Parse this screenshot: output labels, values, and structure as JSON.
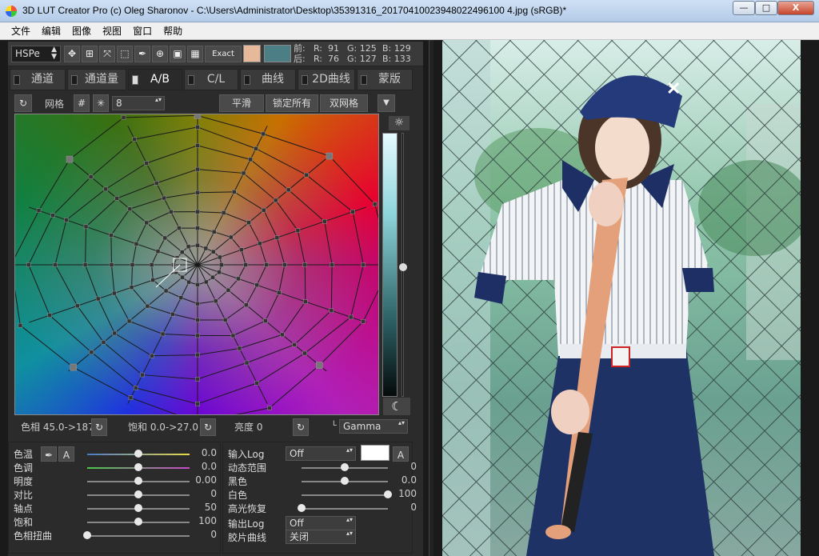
{
  "window": {
    "title": "3D LUT Creator Pro (c) Oleg Sharonov - C:\\Users\\Administrator\\Desktop\\35391316_20170410023948022496100 4.jpg (sRGB)*",
    "min": "—",
    "max": "□",
    "close": "X"
  },
  "menu": [
    "文件",
    "编辑",
    "图像",
    "视图",
    "窗口",
    "帮助"
  ],
  "toolbar": {
    "mode": "HSPe",
    "exact": "Exact",
    "before_label": "前:",
    "after_label": "后:",
    "before_r": "R:  91",
    "before_g": "G: 125",
    "before_b": "B: 129",
    "after_r": "R:  76",
    "after_g": "G: 127",
    "after_b": "B: 133",
    "before_color": "#e8b89a",
    "after_color": "#4c7f85"
  },
  "tabs": [
    "通道",
    "通道量",
    "A/B",
    "C/L",
    "曲线",
    "2D曲线",
    "蒙版"
  ],
  "grid_row": {
    "label": "网格",
    "value": "8",
    "smooth": "平滑",
    "lock_all": "锁定所有",
    "dual_grid": "双网格"
  },
  "status": {
    "hue": "色相 45.0->187",
    "sat": "饱和 0.0->27.0",
    "bright": "亮度  0",
    "l": "L",
    "gamma": "Gamma"
  },
  "left_sliders": [
    {
      "label": "色温",
      "value": "0.0",
      "pos": 0.5
    },
    {
      "label": "色调",
      "value": "0.0",
      "pos": 0.5
    },
    {
      "label": "明度",
      "value": "0.00",
      "pos": 0.5
    },
    {
      "label": "对比",
      "value": "0",
      "pos": 0.5
    },
    {
      "label": "轴点",
      "value": "50",
      "pos": 0.5
    },
    {
      "label": "饱和",
      "value": "100",
      "pos": 0.5
    },
    {
      "label": "色相扭曲",
      "value": "0",
      "pos": 0.0
    }
  ],
  "right_panel": {
    "input_log": "输入Log",
    "input_log_value": "Off",
    "a": "A",
    "output_log": "输出Log",
    "output_log_value": "Off",
    "film_curve": "胶片曲线",
    "film_curve_value": "关闭",
    "sliders": [
      {
        "label": "动态范围",
        "value": "0",
        "pos": 0.5
      },
      {
        "label": "黑色",
        "value": "0.0",
        "pos": 0.5
      },
      {
        "label": "白色",
        "value": "100",
        "pos": 1.0
      },
      {
        "label": "高光恢复",
        "value": "0",
        "pos": 0.0
      }
    ]
  }
}
